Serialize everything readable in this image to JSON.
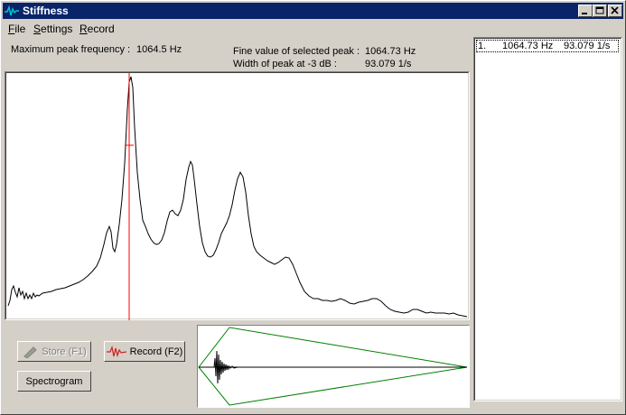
{
  "window": {
    "title": "Stiffness"
  },
  "menu": [
    {
      "accel": "F",
      "rest": "ile"
    },
    {
      "accel": "S",
      "rest": "ettings"
    },
    {
      "accel": "R",
      "rest": "ecord"
    }
  ],
  "info": {
    "max_peak_label": "Maximum peak frequency :",
    "max_peak_value": "1064.5 Hz",
    "fine_value_label": "Fine value of selected peak :",
    "fine_value_value": "1064.73 Hz",
    "width_label": "Width of peak at -3 dB :",
    "width_value": "93.079 1/s"
  },
  "buttons": {
    "store": "Store (F1)",
    "record": "Record (F2)",
    "spectrogram": "Spectrogram"
  },
  "peaks": [
    {
      "index": "1.",
      "frequency": "1064.73 Hz",
      "width": "93.079 1/s"
    }
  ],
  "colors": {
    "titlebar": "#0a246a",
    "spectrum_line": "#000000",
    "marker": "#ff0000",
    "envelope": "#008000"
  }
}
